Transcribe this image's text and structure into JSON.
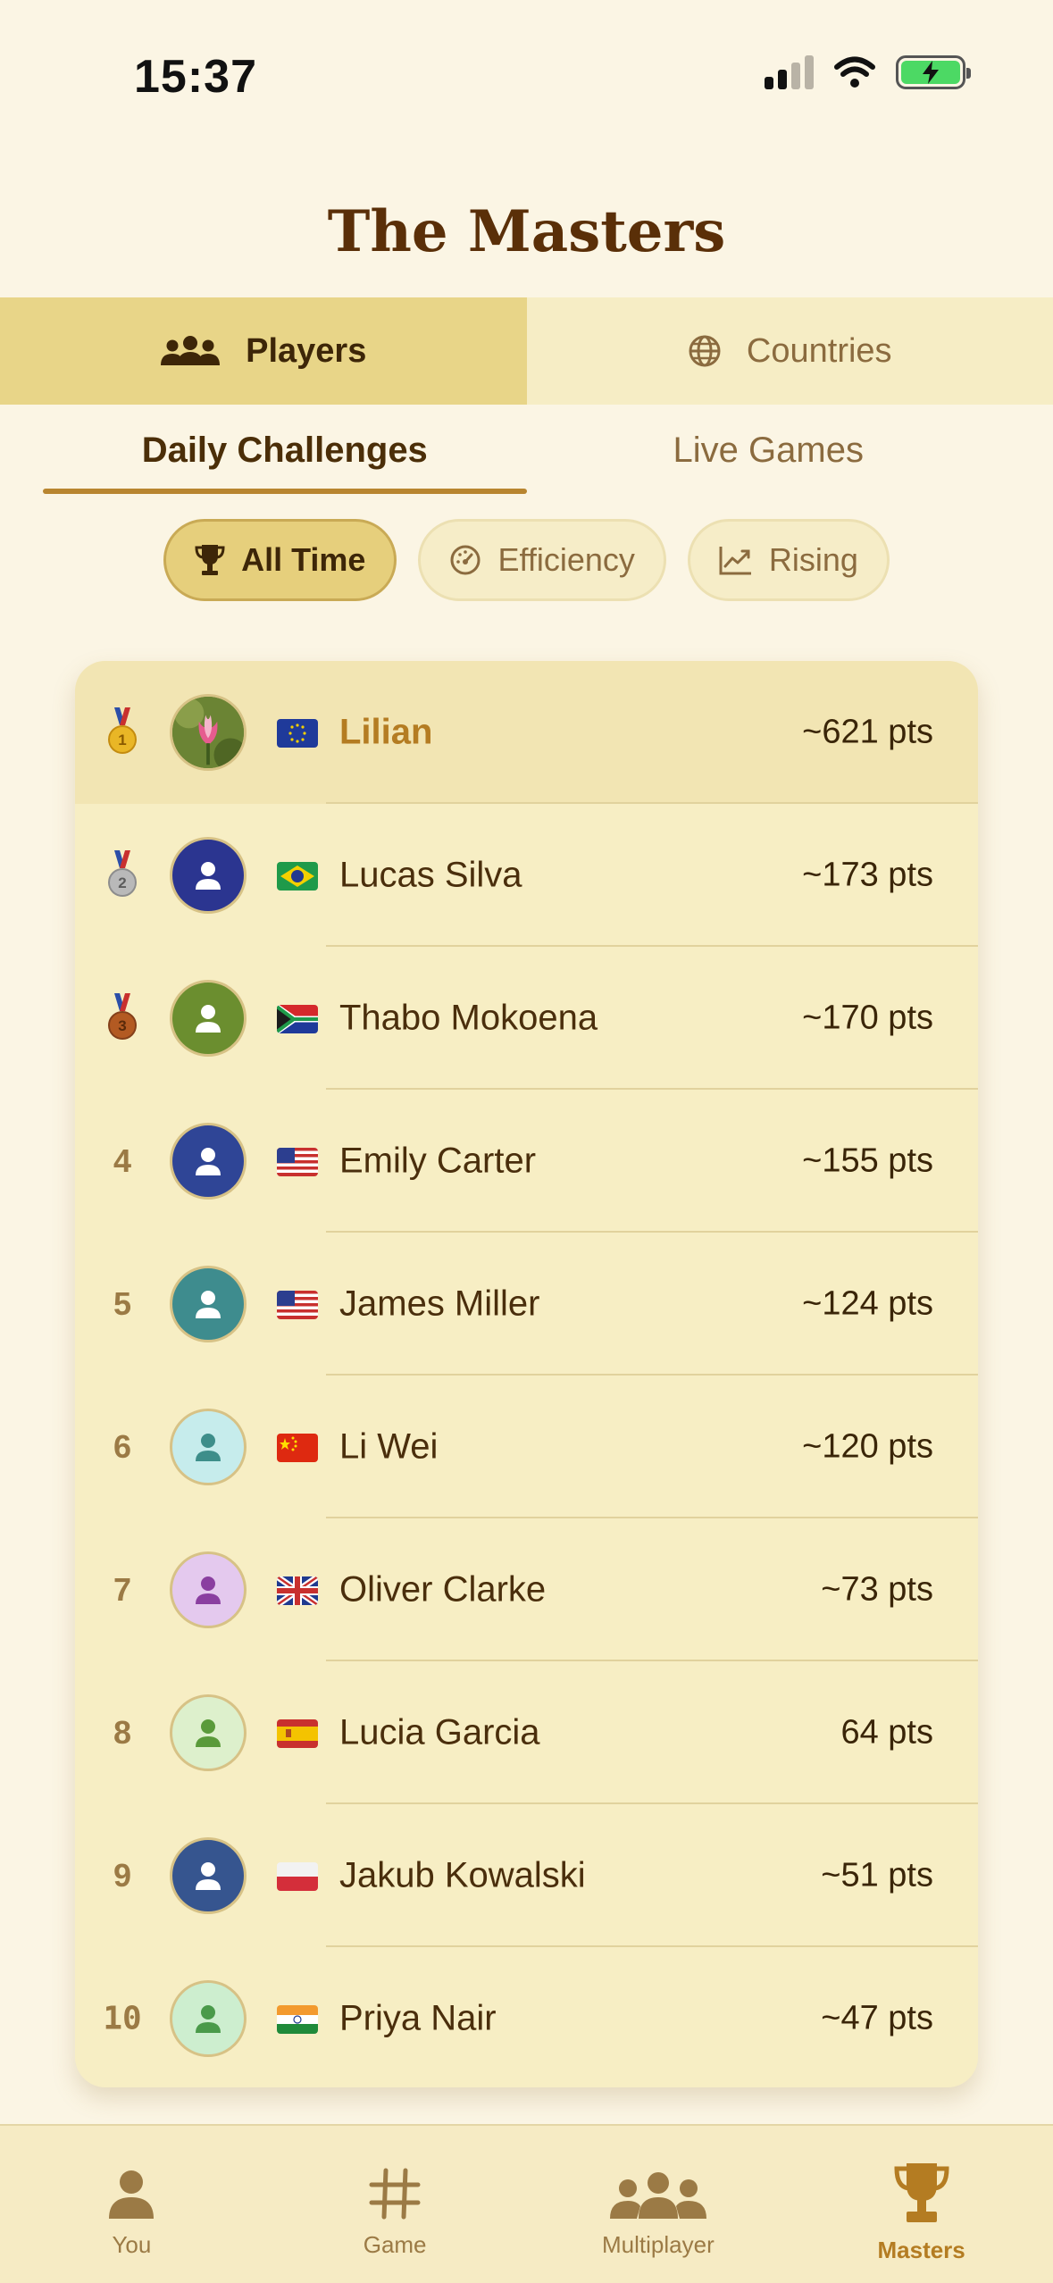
{
  "status_bar": {
    "time": "15:37"
  },
  "title": "The Masters",
  "top_tabs": [
    {
      "label": "Players",
      "icon": "group-icon",
      "active": true
    },
    {
      "label": "Countries",
      "icon": "globe-icon",
      "active": false
    }
  ],
  "sub_tabs": [
    {
      "label": "Daily Challenges",
      "active": true
    },
    {
      "label": "Live Games",
      "active": false
    }
  ],
  "filters": [
    {
      "label": "All Time",
      "icon": "trophy-icon",
      "active": true
    },
    {
      "label": "Efficiency",
      "icon": "speedometer-icon",
      "active": false
    },
    {
      "label": "Rising",
      "icon": "trending-up-icon",
      "active": false
    }
  ],
  "leaderboard": [
    {
      "rank": "1",
      "medal": "gold",
      "name": "Lilian",
      "flag": "EU",
      "points": "~621 pts",
      "avatar": "photo",
      "is_me": true
    },
    {
      "rank": "2",
      "medal": "silver",
      "name": "Lucas Silva",
      "flag": "BR",
      "points": "~173 pts",
      "avatar_color": "#2b3590"
    },
    {
      "rank": "3",
      "medal": "bronze",
      "name": "Thabo Mokoena",
      "flag": "ZA",
      "points": "~170 pts",
      "avatar_color": "#6b8e2f"
    },
    {
      "rank": "4",
      "name": "Emily Carter",
      "flag": "US",
      "points": "~155 pts",
      "avatar_color": "#2f4596"
    },
    {
      "rank": "5",
      "name": "James Miller",
      "flag": "US",
      "points": "~124 pts",
      "avatar_color": "#3e8c8e"
    },
    {
      "rank": "6",
      "name": "Li Wei",
      "flag": "CN",
      "points": "~120 pts",
      "avatar_color": "#c6ecec"
    },
    {
      "rank": "7",
      "name": "Oliver Clarke",
      "flag": "GB",
      "points": "~73 pts",
      "avatar_color": "#e4c9ee"
    },
    {
      "rank": "8",
      "name": "Lucia Garcia",
      "flag": "ES",
      "points": "64 pts",
      "avatar_color": "#ddf0cc"
    },
    {
      "rank": "9",
      "name": "Jakub Kowalski",
      "flag": "PL",
      "points": "~51 pts",
      "avatar_color": "#36558f"
    },
    {
      "rank": "10",
      "name": "Priya Nair",
      "flag": "IN",
      "points": "~47 pts",
      "avatar_color": "#cdeecf"
    }
  ],
  "bottom_nav": [
    {
      "label": "You",
      "icon": "person-icon",
      "active": false
    },
    {
      "label": "Game",
      "icon": "grid-hash-icon",
      "active": false
    },
    {
      "label": "Multiplayer",
      "icon": "people-icon",
      "active": false
    },
    {
      "label": "Masters",
      "icon": "trophy-icon",
      "active": true
    }
  ],
  "colors": {
    "background": "#fbf5e4",
    "accent": "#b8852f",
    "active_tab": "#e8d588",
    "card": "#f7eec4"
  }
}
